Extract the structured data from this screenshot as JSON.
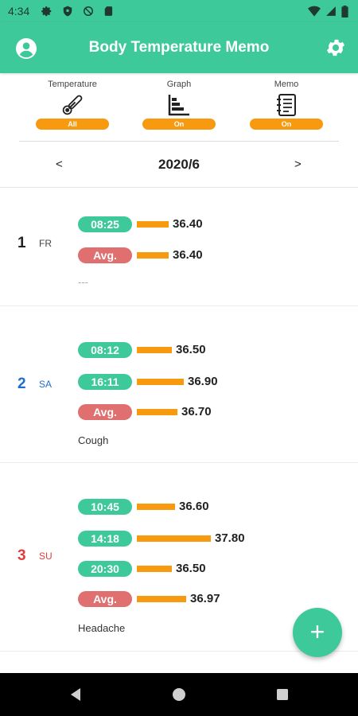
{
  "status_bar": {
    "time": "4:34",
    "icons": [
      "gear-icon",
      "shield-icon",
      "no-sync-icon",
      "sd-card-icon",
      "wifi-icon",
      "cell-signal-icon",
      "battery-icon"
    ]
  },
  "app_bar": {
    "title": "Body Temperature Memo",
    "left_icon": "account-circle-icon",
    "right_icon": "gear-icon",
    "color": "#3ec99a"
  },
  "toggles": [
    {
      "label": "Temperature",
      "icon": "thermometer-icon",
      "value": "All"
    },
    {
      "label": "Graph",
      "icon": "bar-chart-icon",
      "value": "On"
    },
    {
      "label": "Memo",
      "icon": "notepad-icon",
      "value": "On"
    }
  ],
  "month_nav": {
    "prev": "<",
    "month": "2020/6",
    "next": ">"
  },
  "colors": {
    "accent": "#3ec99a",
    "bar": "#f79a0f",
    "avg_tag": "#e07070",
    "saturday": "#1e6ecb",
    "sunday": "#e33b3b"
  },
  "days": [
    {
      "day": "1",
      "weekday": "FR",
      "readings": [
        {
          "time": "08:25",
          "temp": "36.40",
          "value": 36.4
        },
        {
          "time": "Avg.",
          "temp": "36.40",
          "value": 36.4,
          "avg": true
        }
      ],
      "memo": "---"
    },
    {
      "day": "2",
      "weekday": "SA",
      "readings": [
        {
          "time": "08:12",
          "temp": "36.50",
          "value": 36.5
        },
        {
          "time": "16:11",
          "temp": "36.90",
          "value": 36.9
        },
        {
          "time": "Avg.",
          "temp": "36.70",
          "value": 36.7,
          "avg": true
        }
      ],
      "memo": "Cough"
    },
    {
      "day": "3",
      "weekday": "SU",
      "readings": [
        {
          "time": "10:45",
          "temp": "36.60",
          "value": 36.6
        },
        {
          "time": "14:18",
          "temp": "37.80",
          "value": 37.8
        },
        {
          "time": "20:30",
          "temp": "36.50",
          "value": 36.5
        },
        {
          "time": "Avg.",
          "temp": "36.97",
          "value": 36.97,
          "avg": true
        }
      ],
      "memo": "Headache"
    }
  ],
  "fab": {
    "label": "+",
    "icon": "plus-icon"
  },
  "nav_bar": [
    "back-icon",
    "home-icon",
    "recents-icon"
  ]
}
